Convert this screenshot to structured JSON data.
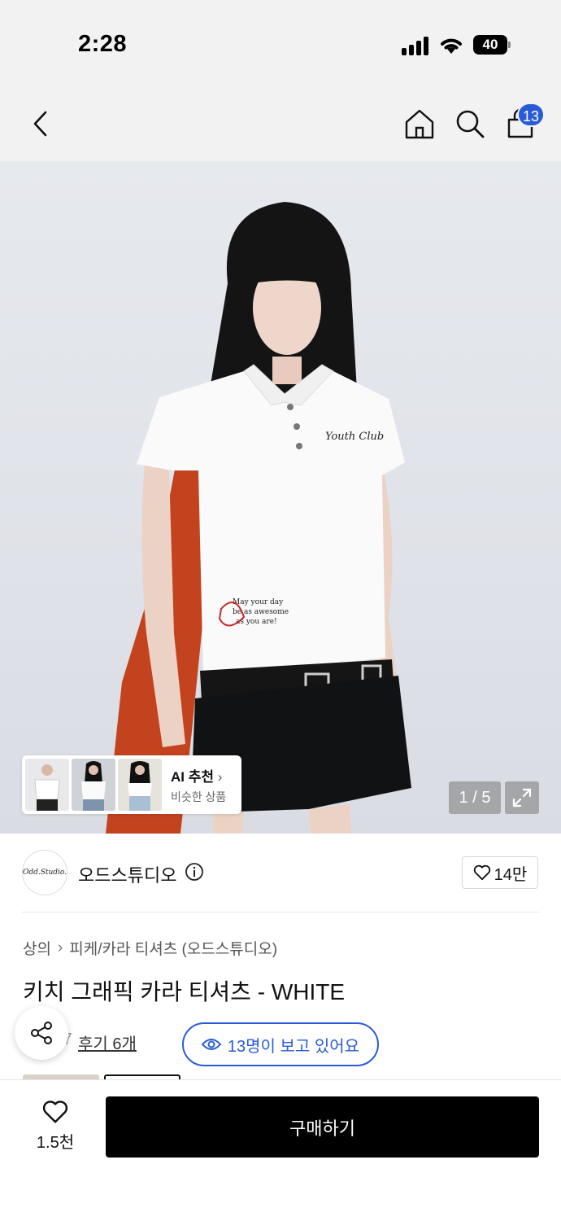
{
  "status_bar": {
    "time": "2:28",
    "battery": "40"
  },
  "header": {
    "cart_count": "13"
  },
  "hero": {
    "ai_reco_title": "AI 추천",
    "ai_reco_subtitle": "비슷한 상품",
    "page_indicator": "1 / 5",
    "print_text": "May your day be as awesome as you are!",
    "logo_text": "Youth Club"
  },
  "brand": {
    "logo_text": "Odd.Studio.",
    "name": "오드스튜디오",
    "like_count": "14만"
  },
  "product": {
    "breadcrumb": [
      "상의",
      "피케/카라 티셔츠 (오드스튜디오)"
    ],
    "title": "키치 그래픽 카라 티셔츠 - WHITE",
    "rating_fragment": ".7",
    "review_link": "후기 6개",
    "viewers": "13명이 보고 있어요"
  },
  "bottom_bar": {
    "wish_count": "1.5천",
    "buy_label": "구매하기"
  },
  "colors": {
    "accent": "#2a5bd7",
    "buy_button": "#000000"
  }
}
